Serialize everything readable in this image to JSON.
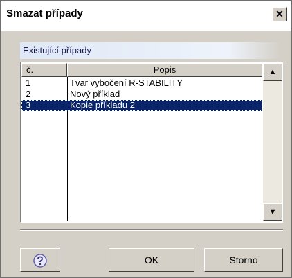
{
  "dialog": {
    "title": "Smazat případy",
    "close_glyph": "✕"
  },
  "group": {
    "label": "Existující případy"
  },
  "table": {
    "columns": [
      "č.",
      "Popis"
    ],
    "rows": [
      {
        "no": "1",
        "desc": "Tvar vybočení R-STABILITY"
      },
      {
        "no": "2",
        "desc": "Nový příklad"
      },
      {
        "no": "3",
        "desc": "Kopie příkladu 2"
      }
    ],
    "selected_index": 2
  },
  "scroll": {
    "up_glyph": "▲",
    "down_glyph": "▼"
  },
  "buttons": {
    "help_icon": "help-icon",
    "ok": "OK",
    "cancel": "Storno"
  },
  "colors": {
    "selection": "#0a246a",
    "face": "#d4d0c8"
  }
}
